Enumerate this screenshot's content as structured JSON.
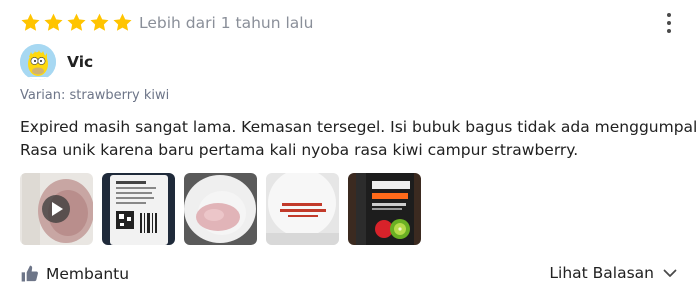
{
  "review": {
    "rating": 5,
    "max_rating": 5,
    "time_label": "Lebih dari 1 tahun lalu",
    "user": {
      "name": "Vic"
    },
    "variant_label": "Varian: strawberry kiwi",
    "text_lines": [
      "Expired masih sangat lama. Kemasan tersegel. Isi bubuk bagus tidak ada menggumpal.",
      "Rasa unik karena baru pertama kali nyoba rasa kiwi campur strawberry."
    ],
    "media": [
      {
        "type": "video",
        "icon": "play-icon"
      },
      {
        "type": "image",
        "label": "XTEND"
      },
      {
        "type": "image"
      },
      {
        "type": "image",
        "label": "BEST BY 03 2023 03"
      },
      {
        "type": "image",
        "label": "XTEND ORIGINAL 7G BCAA"
      }
    ]
  },
  "actions": {
    "helpful_label": "Membantu",
    "helpful_icon": "thumbs-up-icon",
    "replies_label": "Lihat Balasan",
    "replies_icon": "chevron-down-icon"
  },
  "colors": {
    "star": "#FFC400",
    "muted_text": "#8a8f99",
    "variant_text": "#6d7588"
  }
}
